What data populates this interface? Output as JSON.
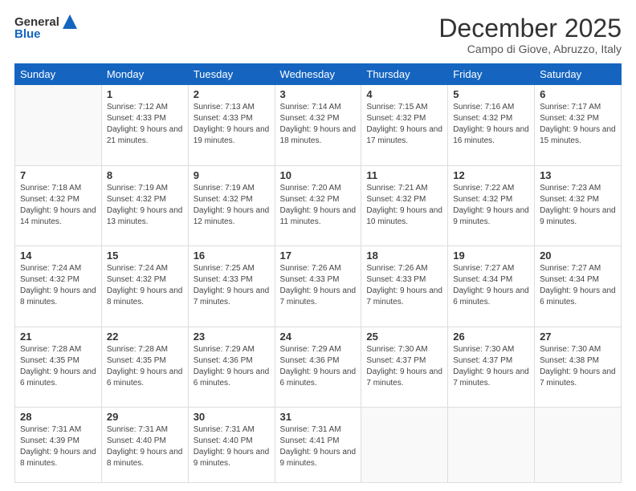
{
  "header": {
    "logo_general": "General",
    "logo_blue": "Blue",
    "month_title": "December 2025",
    "location": "Campo di Giove, Abruzzo, Italy"
  },
  "days_of_week": [
    "Sunday",
    "Monday",
    "Tuesday",
    "Wednesday",
    "Thursday",
    "Friday",
    "Saturday"
  ],
  "weeks": [
    [
      {
        "day": "",
        "sunrise": "",
        "sunset": "",
        "daylight": ""
      },
      {
        "day": "1",
        "sunrise": "Sunrise: 7:12 AM",
        "sunset": "Sunset: 4:33 PM",
        "daylight": "Daylight: 9 hours and 21 minutes."
      },
      {
        "day": "2",
        "sunrise": "Sunrise: 7:13 AM",
        "sunset": "Sunset: 4:33 PM",
        "daylight": "Daylight: 9 hours and 19 minutes."
      },
      {
        "day": "3",
        "sunrise": "Sunrise: 7:14 AM",
        "sunset": "Sunset: 4:32 PM",
        "daylight": "Daylight: 9 hours and 18 minutes."
      },
      {
        "day": "4",
        "sunrise": "Sunrise: 7:15 AM",
        "sunset": "Sunset: 4:32 PM",
        "daylight": "Daylight: 9 hours and 17 minutes."
      },
      {
        "day": "5",
        "sunrise": "Sunrise: 7:16 AM",
        "sunset": "Sunset: 4:32 PM",
        "daylight": "Daylight: 9 hours and 16 minutes."
      },
      {
        "day": "6",
        "sunrise": "Sunrise: 7:17 AM",
        "sunset": "Sunset: 4:32 PM",
        "daylight": "Daylight: 9 hours and 15 minutes."
      }
    ],
    [
      {
        "day": "7",
        "sunrise": "Sunrise: 7:18 AM",
        "sunset": "Sunset: 4:32 PM",
        "daylight": "Daylight: 9 hours and 14 minutes."
      },
      {
        "day": "8",
        "sunrise": "Sunrise: 7:19 AM",
        "sunset": "Sunset: 4:32 PM",
        "daylight": "Daylight: 9 hours and 13 minutes."
      },
      {
        "day": "9",
        "sunrise": "Sunrise: 7:19 AM",
        "sunset": "Sunset: 4:32 PM",
        "daylight": "Daylight: 9 hours and 12 minutes."
      },
      {
        "day": "10",
        "sunrise": "Sunrise: 7:20 AM",
        "sunset": "Sunset: 4:32 PM",
        "daylight": "Daylight: 9 hours and 11 minutes."
      },
      {
        "day": "11",
        "sunrise": "Sunrise: 7:21 AM",
        "sunset": "Sunset: 4:32 PM",
        "daylight": "Daylight: 9 hours and 10 minutes."
      },
      {
        "day": "12",
        "sunrise": "Sunrise: 7:22 AM",
        "sunset": "Sunset: 4:32 PM",
        "daylight": "Daylight: 9 hours and 9 minutes."
      },
      {
        "day": "13",
        "sunrise": "Sunrise: 7:23 AM",
        "sunset": "Sunset: 4:32 PM",
        "daylight": "Daylight: 9 hours and 9 minutes."
      }
    ],
    [
      {
        "day": "14",
        "sunrise": "Sunrise: 7:24 AM",
        "sunset": "Sunset: 4:32 PM",
        "daylight": "Daylight: 9 hours and 8 minutes."
      },
      {
        "day": "15",
        "sunrise": "Sunrise: 7:24 AM",
        "sunset": "Sunset: 4:32 PM",
        "daylight": "Daylight: 9 hours and 8 minutes."
      },
      {
        "day": "16",
        "sunrise": "Sunrise: 7:25 AM",
        "sunset": "Sunset: 4:33 PM",
        "daylight": "Daylight: 9 hours and 7 minutes."
      },
      {
        "day": "17",
        "sunrise": "Sunrise: 7:26 AM",
        "sunset": "Sunset: 4:33 PM",
        "daylight": "Daylight: 9 hours and 7 minutes."
      },
      {
        "day": "18",
        "sunrise": "Sunrise: 7:26 AM",
        "sunset": "Sunset: 4:33 PM",
        "daylight": "Daylight: 9 hours and 7 minutes."
      },
      {
        "day": "19",
        "sunrise": "Sunrise: 7:27 AM",
        "sunset": "Sunset: 4:34 PM",
        "daylight": "Daylight: 9 hours and 6 minutes."
      },
      {
        "day": "20",
        "sunrise": "Sunrise: 7:27 AM",
        "sunset": "Sunset: 4:34 PM",
        "daylight": "Daylight: 9 hours and 6 minutes."
      }
    ],
    [
      {
        "day": "21",
        "sunrise": "Sunrise: 7:28 AM",
        "sunset": "Sunset: 4:35 PM",
        "daylight": "Daylight: 9 hours and 6 minutes."
      },
      {
        "day": "22",
        "sunrise": "Sunrise: 7:28 AM",
        "sunset": "Sunset: 4:35 PM",
        "daylight": "Daylight: 9 hours and 6 minutes."
      },
      {
        "day": "23",
        "sunrise": "Sunrise: 7:29 AM",
        "sunset": "Sunset: 4:36 PM",
        "daylight": "Daylight: 9 hours and 6 minutes."
      },
      {
        "day": "24",
        "sunrise": "Sunrise: 7:29 AM",
        "sunset": "Sunset: 4:36 PM",
        "daylight": "Daylight: 9 hours and 6 minutes."
      },
      {
        "day": "25",
        "sunrise": "Sunrise: 7:30 AM",
        "sunset": "Sunset: 4:37 PM",
        "daylight": "Daylight: 9 hours and 7 minutes."
      },
      {
        "day": "26",
        "sunrise": "Sunrise: 7:30 AM",
        "sunset": "Sunset: 4:37 PM",
        "daylight": "Daylight: 9 hours and 7 minutes."
      },
      {
        "day": "27",
        "sunrise": "Sunrise: 7:30 AM",
        "sunset": "Sunset: 4:38 PM",
        "daylight": "Daylight: 9 hours and 7 minutes."
      }
    ],
    [
      {
        "day": "28",
        "sunrise": "Sunrise: 7:31 AM",
        "sunset": "Sunset: 4:39 PM",
        "daylight": "Daylight: 9 hours and 8 minutes."
      },
      {
        "day": "29",
        "sunrise": "Sunrise: 7:31 AM",
        "sunset": "Sunset: 4:40 PM",
        "daylight": "Daylight: 9 hours and 8 minutes."
      },
      {
        "day": "30",
        "sunrise": "Sunrise: 7:31 AM",
        "sunset": "Sunset: 4:40 PM",
        "daylight": "Daylight: 9 hours and 9 minutes."
      },
      {
        "day": "31",
        "sunrise": "Sunrise: 7:31 AM",
        "sunset": "Sunset: 4:41 PM",
        "daylight": "Daylight: 9 hours and 9 minutes."
      },
      {
        "day": "",
        "sunrise": "",
        "sunset": "",
        "daylight": ""
      },
      {
        "day": "",
        "sunrise": "",
        "sunset": "",
        "daylight": ""
      },
      {
        "day": "",
        "sunrise": "",
        "sunset": "",
        "daylight": ""
      }
    ]
  ]
}
